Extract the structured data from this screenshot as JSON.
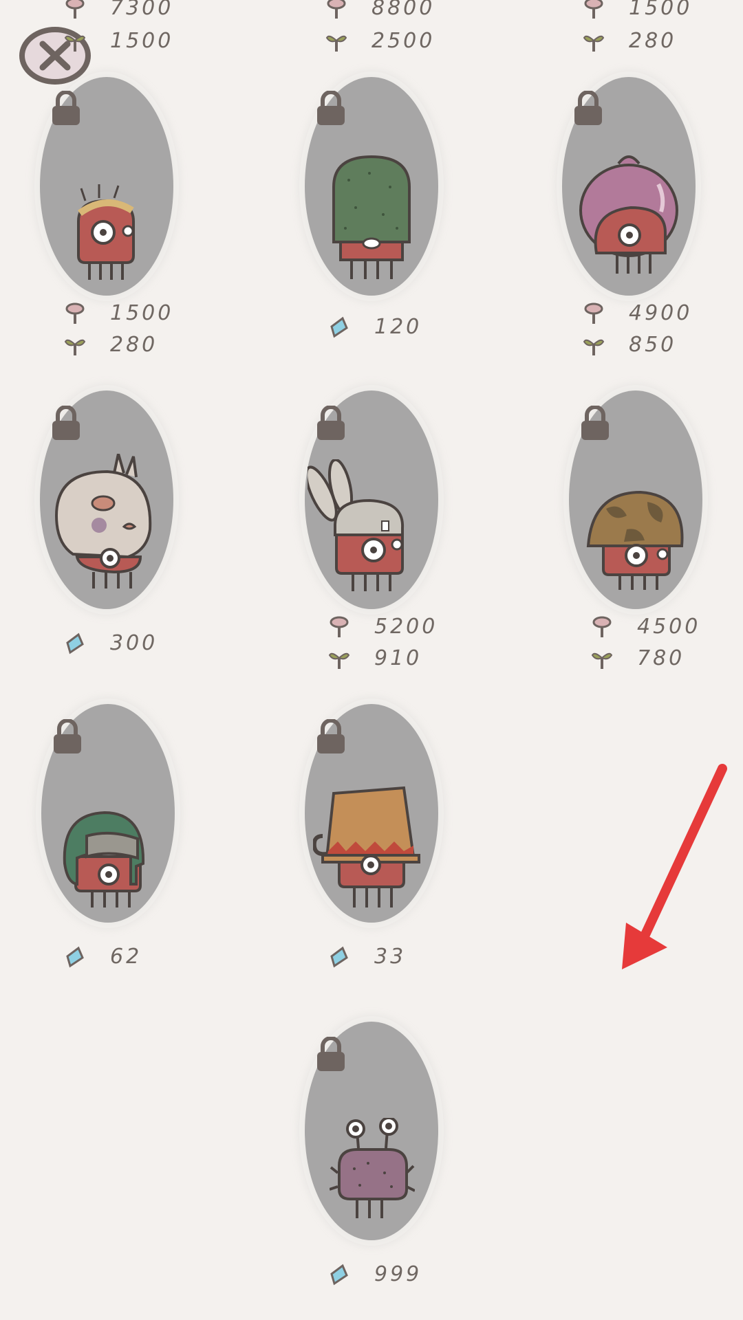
{
  "screen": "hat-shop",
  "colors": {
    "background": "#f4f1ee",
    "oval": "#a7a6a6",
    "lock": "#6e6460",
    "text": "#6f6762",
    "arrow": "#e63a3a"
  },
  "close_button": {
    "icon": "close-x-icon"
  },
  "top_row_prices": [
    {
      "mushroom": "7300",
      "sprout": "1500"
    },
    {
      "mushroom": "8800",
      "sprout": "2500"
    },
    {
      "mushroom": "1500",
      "sprout": "280"
    }
  ],
  "items": [
    {
      "name": "crown-hat-creature",
      "locked": true,
      "price": {
        "mushroom": "1500",
        "sprout": "280"
      }
    },
    {
      "name": "cactus-hat-creature",
      "locked": true,
      "price": {
        "gem": "120"
      }
    },
    {
      "name": "onion-hat-creature",
      "locked": true,
      "price": {
        "mushroom": "4900",
        "sprout": "850"
      }
    },
    {
      "name": "skull-mask-creature",
      "locked": true,
      "price": {
        "gem": "300"
      }
    },
    {
      "name": "bunny-hat-creature",
      "locked": true,
      "price": {
        "mushroom": "5200",
        "sprout": "910"
      }
    },
    {
      "name": "camo-helmet-creature",
      "locked": true,
      "price": {
        "mushroom": "4500",
        "sprout": "780"
      }
    },
    {
      "name": "aviator-hat-creature",
      "locked": true,
      "price": {
        "gem": "62"
      }
    },
    {
      "name": "bucket-hat-creature",
      "locked": true,
      "price": {
        "gem": "33"
      }
    },
    {
      "name": "bug-creature",
      "locked": true,
      "price": {
        "gem": "999"
      }
    }
  ]
}
